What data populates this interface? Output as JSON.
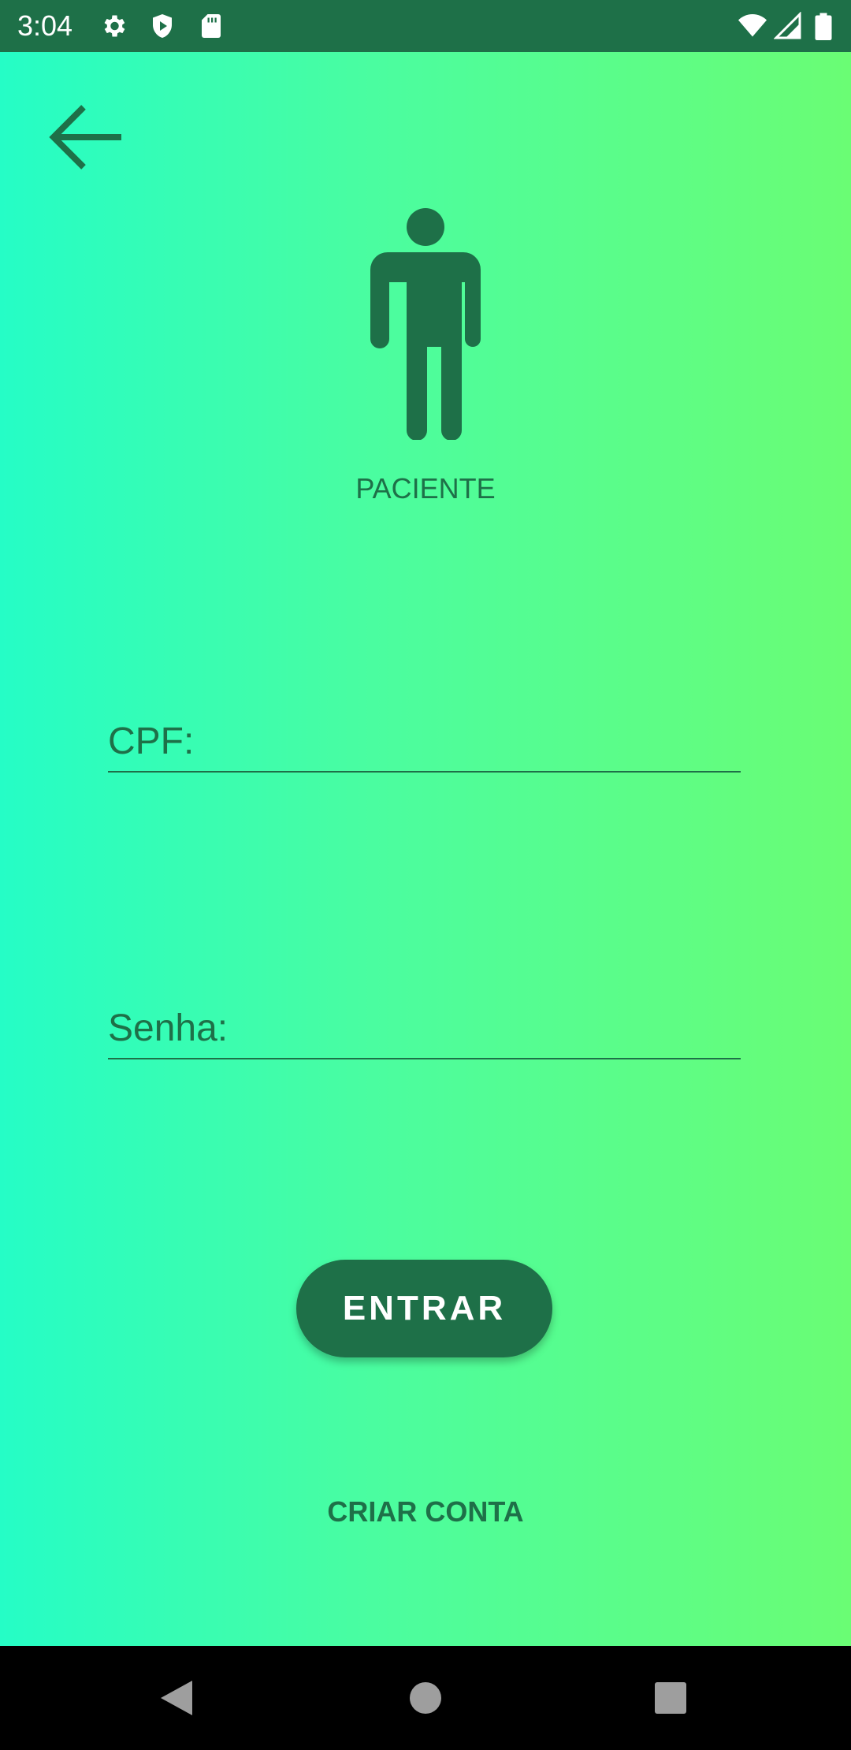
{
  "status_bar": {
    "time": "3:04",
    "icons_left": [
      "settings-icon",
      "shield-play-icon",
      "sd-card-icon"
    ],
    "icons_right": [
      "wifi-icon",
      "signal-icon",
      "battery-icon"
    ]
  },
  "header": {
    "back_icon": "arrow-back-icon"
  },
  "profile": {
    "icon": "person-icon",
    "label": "PACIENTE"
  },
  "form": {
    "cpf_placeholder": "CPF:",
    "cpf_value": "",
    "password_placeholder": "Senha:",
    "password_value": ""
  },
  "actions": {
    "enter_label": "ENTRAR",
    "create_account_label": "CRIAR CONTA"
  },
  "nav_bar": {
    "icons": [
      "back-triangle-icon",
      "home-circle-icon",
      "recents-square-icon"
    ]
  },
  "colors": {
    "status_bar": "#1e7048",
    "primary_dark_green": "#1e7048",
    "gradient_start": "#25fdc6",
    "gradient_end": "#6afd74",
    "nav_bar": "#000000"
  }
}
